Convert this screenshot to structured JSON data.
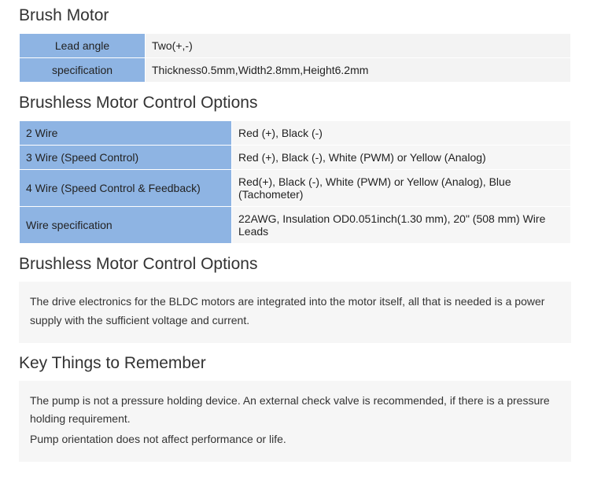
{
  "brush_motor": {
    "title": "Brush Motor",
    "rows": [
      {
        "label": "Lead angle",
        "value": "Two(+,-)"
      },
      {
        "label": "specification",
        "value": "Thickness0.5mm,Width2.8mm,Height6.2mm"
      }
    ]
  },
  "brushless_options": {
    "title": "Brushless Motor Control Options",
    "rows": [
      {
        "label": "2 Wire",
        "value": "Red (+), Black (-)"
      },
      {
        "label": "3 Wire (Speed Control)",
        "value": "Red (+), Black (-), White (PWM) or Yellow (Analog)"
      },
      {
        "label": "4 Wire (Speed Control & Feedback)",
        "value": "Red(+), Black (-), White (PWM) or Yellow (Analog), Blue (Tachometer)"
      },
      {
        "label": "Wire specification",
        "value": "22AWG, Insulation OD0.051inch(1.30 mm), 20\" (508 mm) Wire Leads"
      }
    ]
  },
  "brushless_note": {
    "title": "Brushless Motor Control Options",
    "text": "The drive electronics for the BLDC motors are integrated into the motor itself, all that is needed is a power supply with the sufficient voltage and current."
  },
  "key_things": {
    "title": "Key Things to Remember",
    "paragraphs": [
      "The pump is not a pressure holding device. An external check valve is recommended, if there is a pressure holding requirement.",
      "Pump orientation does not affect performance or life."
    ]
  }
}
